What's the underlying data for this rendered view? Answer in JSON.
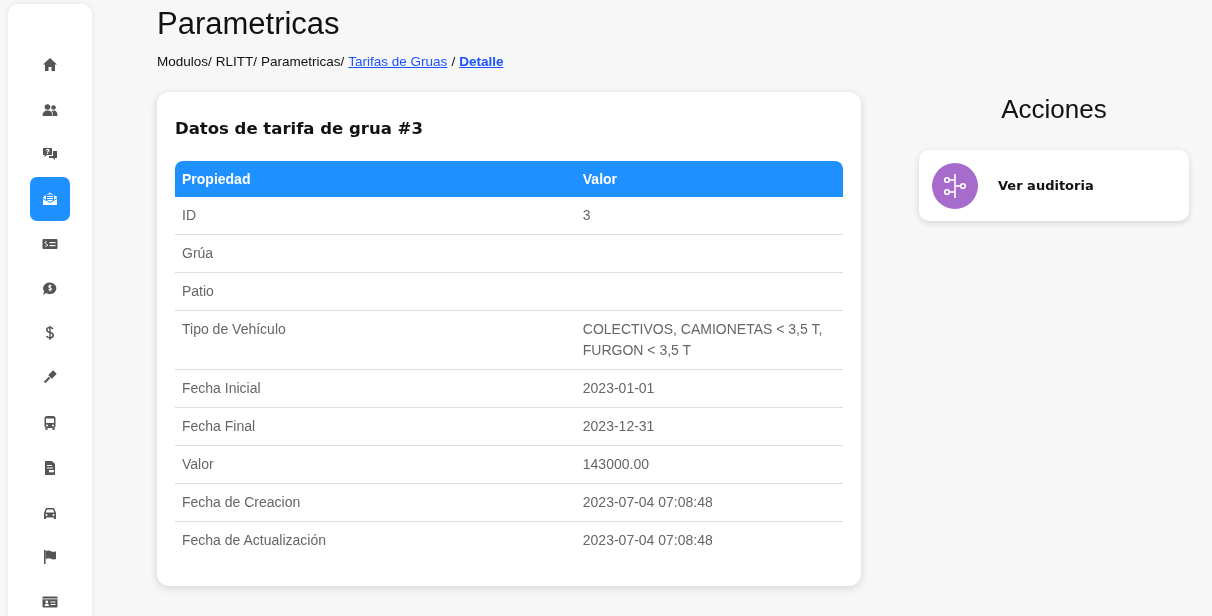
{
  "sidebar": {
    "items": [
      {
        "kind": "home",
        "selected": false
      },
      {
        "kind": "users",
        "selected": false
      },
      {
        "kind": "questions",
        "selected": false
      },
      {
        "kind": "mail",
        "selected": true
      },
      {
        "kind": "bill",
        "selected": false
      },
      {
        "kind": "coin-chat",
        "selected": false
      },
      {
        "kind": "dollar",
        "selected": false
      },
      {
        "kind": "gavel",
        "selected": false
      },
      {
        "kind": "bus",
        "selected": false
      },
      {
        "kind": "document",
        "selected": false
      },
      {
        "kind": "car",
        "selected": false
      },
      {
        "kind": "flag",
        "selected": false
      },
      {
        "kind": "card",
        "selected": false
      }
    ]
  },
  "page": {
    "title": "Parametricas",
    "breadcrumb": [
      {
        "text": "Modulos/",
        "kind": "text"
      },
      {
        "text": "RLITT/",
        "kind": "text"
      },
      {
        "text": "Parametricas/",
        "kind": "text"
      },
      {
        "text": "Tarifas de Gruas",
        "kind": "link"
      },
      {
        "text": "/",
        "kind": "text"
      },
      {
        "text": "Detalle",
        "kind": "current"
      }
    ]
  },
  "detail": {
    "title": "Datos de tarifa de grua #3",
    "table": {
      "columns": [
        "Propiedad",
        "Valor"
      ],
      "rows": [
        [
          "ID",
          "3"
        ],
        [
          "Grúa",
          ""
        ],
        [
          "Patio",
          ""
        ],
        [
          "Tipo de Vehículo",
          "COLECTIVOS, CAMIONETAS < 3,5 T, FURGON < 3,5 T"
        ],
        [
          "Fecha Inicial",
          "2023-01-01"
        ],
        [
          "Fecha Final",
          "2023-12-31"
        ],
        [
          "Valor",
          "143000.00"
        ],
        [
          "Fecha de Creacion",
          "2023-07-04 07:08:48"
        ],
        [
          "Fecha de Actualización",
          "2023-07-04 07:08:48"
        ]
      ]
    }
  },
  "actions": {
    "title": "Acciones",
    "items": [
      {
        "label": "Ver auditoria",
        "color": "#a66bcb"
      }
    ]
  }
}
